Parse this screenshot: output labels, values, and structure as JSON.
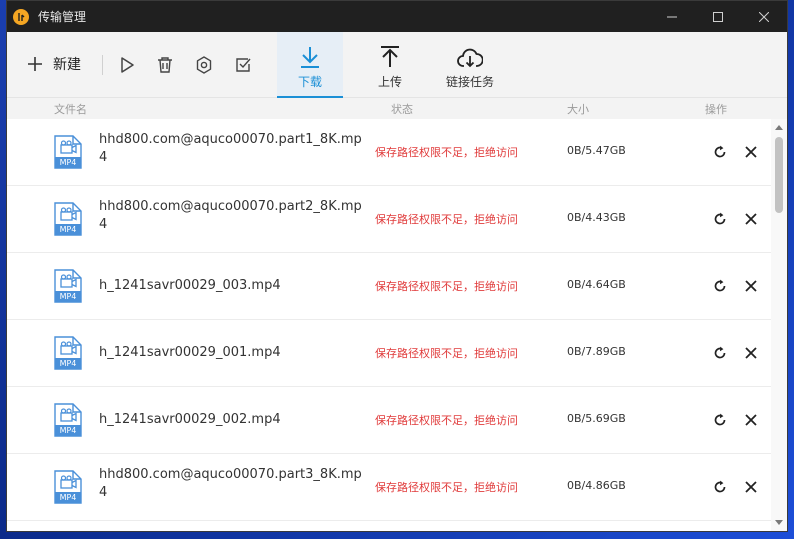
{
  "window": {
    "title": "传输管理",
    "controls": {
      "minimize": "minimize-icon",
      "maximize": "maximize-icon",
      "close": "close-icon"
    }
  },
  "toolbar": {
    "new_label": "新建",
    "tabs": [
      {
        "label": "下载",
        "icon": "download-icon",
        "active": true
      },
      {
        "label": "上传",
        "icon": "upload-icon",
        "active": false
      },
      {
        "label": "链接任务",
        "icon": "cloud-download-icon",
        "active": false
      }
    ]
  },
  "columns": {
    "name": "文件名",
    "status": "状态",
    "size": "大小",
    "actions": "操作"
  },
  "rows": [
    {
      "name": "hhd800.com@aquco00070.part1_8K.mp4",
      "status": "保存路径权限不足，拒绝访问",
      "size": "0B/5.47GB",
      "icon_label": "MP4"
    },
    {
      "name": "hhd800.com@aquco00070.part2_8K.mp4",
      "status": "保存路径权限不足，拒绝访问",
      "size": "0B/4.43GB",
      "icon_label": "MP4"
    },
    {
      "name": "h_1241savr00029_003.mp4",
      "status": "保存路径权限不足，拒绝访问",
      "size": "0B/4.64GB",
      "icon_label": "MP4"
    },
    {
      "name": "h_1241savr00029_001.mp4",
      "status": "保存路径权限不足，拒绝访问",
      "size": "0B/7.89GB",
      "icon_label": "MP4"
    },
    {
      "name": "h_1241savr00029_002.mp4",
      "status": "保存路径权限不足，拒绝访问",
      "size": "0B/5.69GB",
      "icon_label": "MP4"
    },
    {
      "name": "hhd800.com@aquco00070.part3_8K.mp4",
      "status": "保存路径权限不足，拒绝访问",
      "size": "0B/4.86GB",
      "icon_label": "MP4"
    }
  ],
  "colors": {
    "accent": "#1a8fd6",
    "error": "#e03a3a",
    "logo": "#f5a623"
  }
}
